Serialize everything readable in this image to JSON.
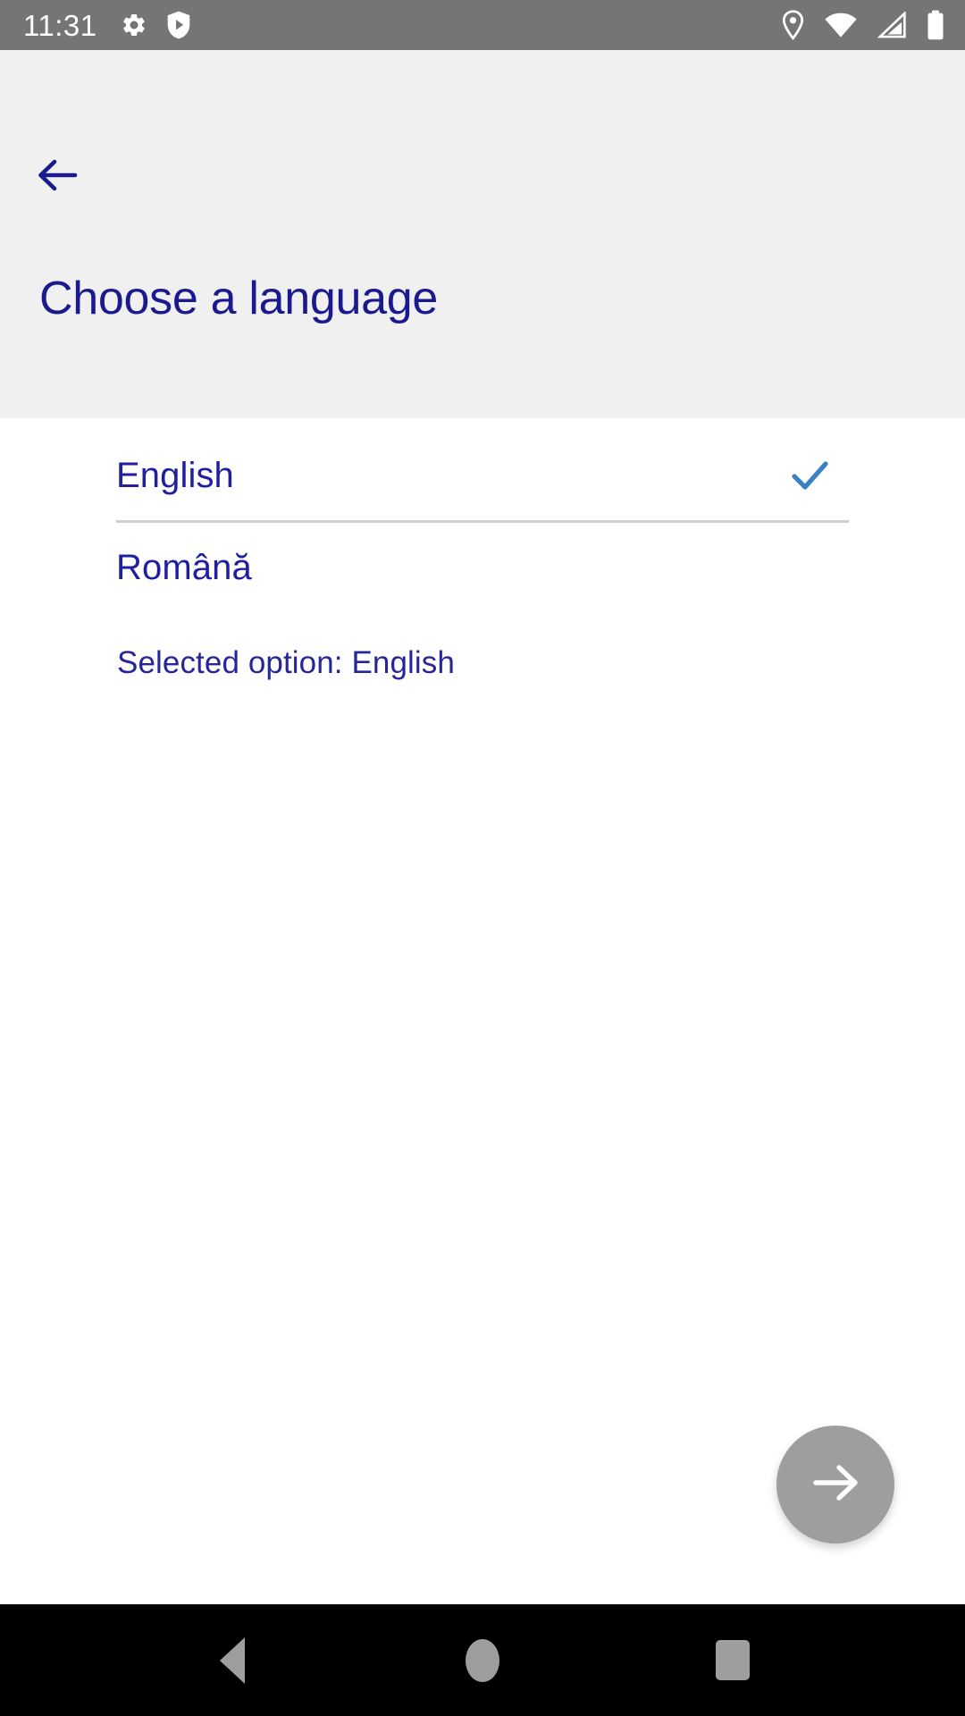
{
  "status_bar": {
    "clock": "11:31",
    "left_icons": [
      "gear-icon",
      "shield-play-icon"
    ],
    "right_icons": [
      "location-pin-icon",
      "wifi-icon",
      "cellular-signal-icon",
      "battery-icon"
    ],
    "background_color": "#757575",
    "foreground_color": "#ffffff"
  },
  "header": {
    "background_color": "#f0f0f0",
    "back_button_icon": "arrow-left-icon",
    "title": "Choose a language",
    "title_color": "#1a1a8e"
  },
  "content": {
    "background_color": "#ffffff",
    "languages": [
      {
        "label": "English",
        "selected": true,
        "check_icon": "check-icon"
      },
      {
        "label": "Română",
        "selected": false,
        "check_icon": ""
      }
    ],
    "selected_option_text": "Selected option: English",
    "text_color": "#1f1fa0",
    "check_color": "#3b82c4",
    "divider_color": "#cfcfcf"
  },
  "fab": {
    "icon": "arrow-right-icon",
    "background_color": "#9e9e9e",
    "icon_color": "#ffffff"
  },
  "nav_bar": {
    "background_color": "#000000",
    "icon_color": "#9e9e9e",
    "buttons": [
      {
        "name": "back",
        "icon": "triangle-left-icon"
      },
      {
        "name": "home",
        "icon": "circle-icon"
      },
      {
        "name": "recents",
        "icon": "square-icon"
      }
    ]
  }
}
